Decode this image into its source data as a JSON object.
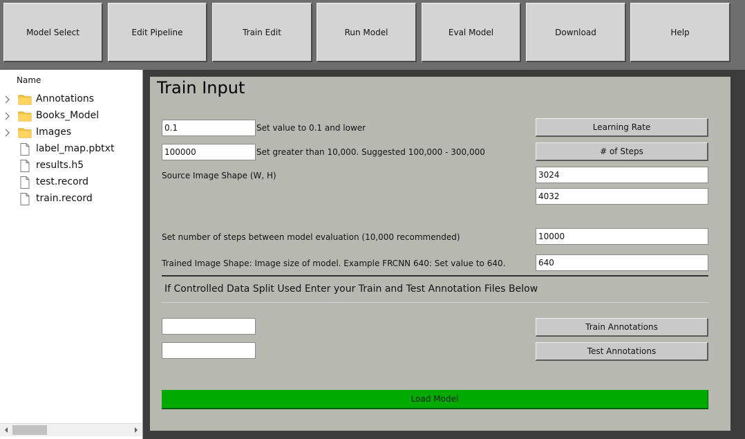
{
  "toolbar": {
    "buttons": [
      "Model Select",
      "Edit Pipeline",
      "Train Edit",
      "Run Model",
      "Eval Model",
      "Download",
      "Help"
    ]
  },
  "file_tree": {
    "header": "Name",
    "items": [
      {
        "label": "Annotations",
        "type": "folder",
        "icon": "folder-icon"
      },
      {
        "label": "Books_Model",
        "type": "folder",
        "icon": "folder-icon"
      },
      {
        "label": "Images",
        "type": "folder",
        "icon": "folder-icon"
      },
      {
        "label": "label_map.pbtxt",
        "type": "file",
        "icon": "file-icon"
      },
      {
        "label": "results.h5",
        "type": "file",
        "icon": "file-icon"
      },
      {
        "label": "test.record",
        "type": "file",
        "icon": "file-icon"
      },
      {
        "label": "train.record",
        "type": "file",
        "icon": "file-icon"
      }
    ]
  },
  "train_input": {
    "title": "Train Input",
    "learning_rate": {
      "value": "0.1",
      "hint": "Set value to 0.1 and lower",
      "button": "Learning Rate"
    },
    "steps": {
      "value": "100000",
      "hint": "Set greater than 10,000. Suggested 100,000 - 300,000",
      "button": "# of Steps"
    },
    "source_shape": {
      "label": "Source Image Shape (W, H)",
      "width": "3024",
      "height": "4032"
    },
    "eval_steps": {
      "label": "Set number of steps between model evaluation (10,000 recommended)",
      "value": "10000"
    },
    "trained_shape": {
      "label": "Trained Image Shape: Image size of model. Example FRCNN 640: Set value to 640.",
      "value": "640"
    },
    "split_heading": "If Controlled Data Split Used Enter your Train and Test Annotation Files Below",
    "train_annotations": {
      "value": "",
      "button": "Train Annotations"
    },
    "test_annotations": {
      "value": "",
      "button": "Test Annotations"
    },
    "load_button": "Load Model"
  },
  "colors": {
    "panel_bg": "#b7b9b1",
    "frame_bg": "#3c3c3c",
    "load_button": "#00aa00",
    "toolbar_button": "#d4d4d4"
  }
}
